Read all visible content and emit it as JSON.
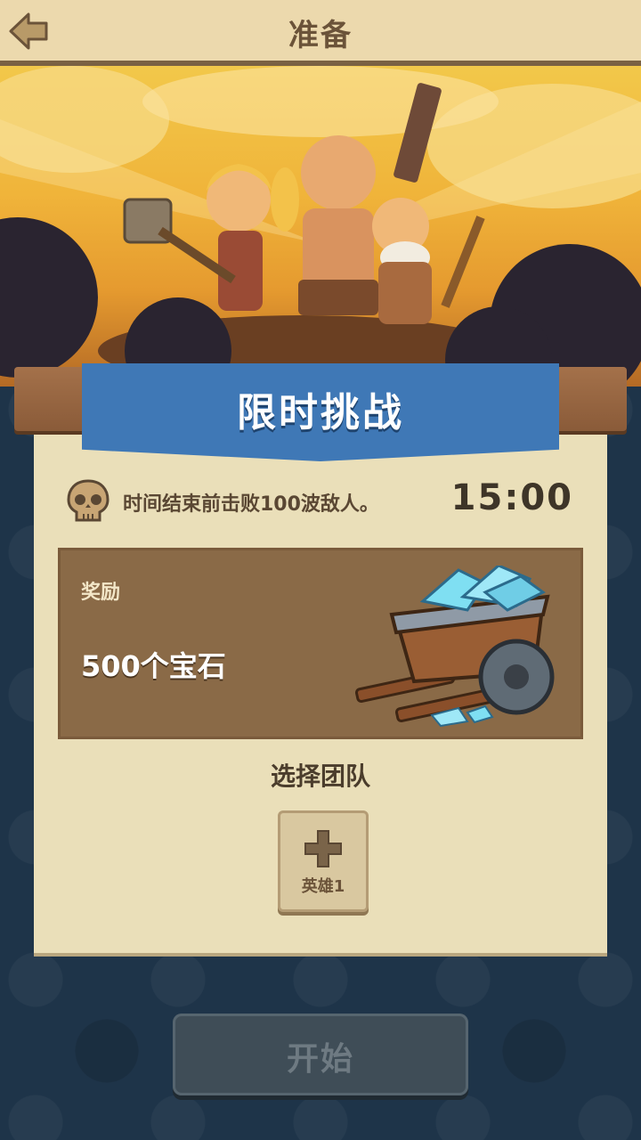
{
  "header": {
    "title": "准备",
    "back_icon": "back-arrow-icon"
  },
  "banner": {
    "title": "限时挑战",
    "ribbon_color": "#3f78b6"
  },
  "objective": {
    "icon": "skull-icon",
    "text": "时间结束前击败100波敌人。",
    "timer": "15:00"
  },
  "reward": {
    "label": "奖励",
    "value": "500个宝石",
    "icon": "gem-cart-icon"
  },
  "team": {
    "heading": "选择团队",
    "slots": [
      {
        "label": "英雄1",
        "icon": "plus-icon"
      }
    ]
  },
  "start_button": {
    "label": "开始",
    "enabled": false
  }
}
